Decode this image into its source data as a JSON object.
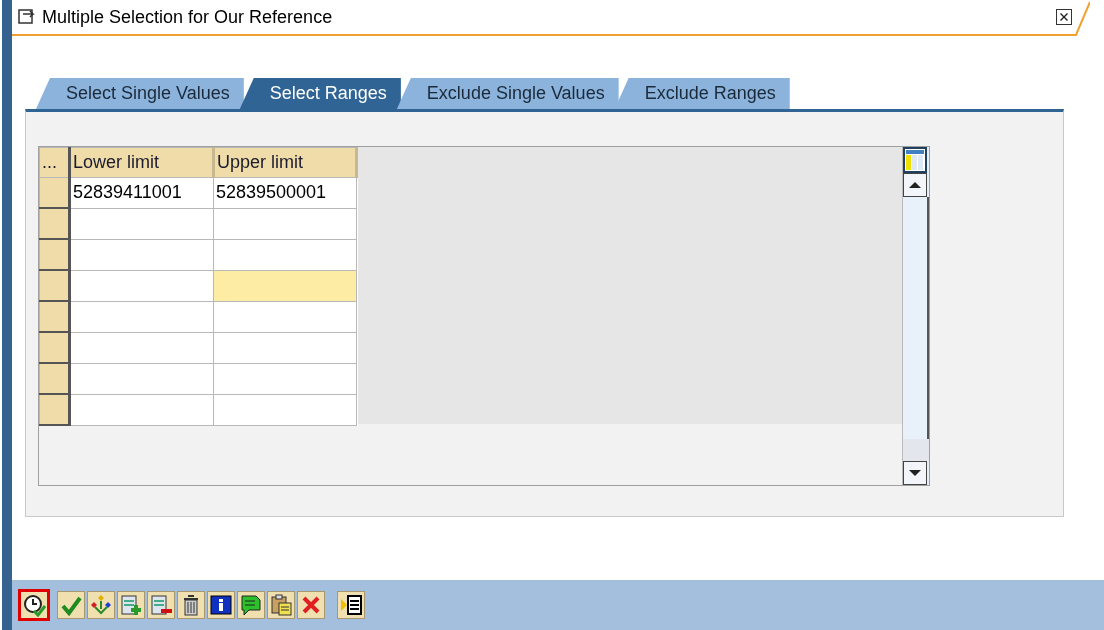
{
  "window": {
    "title": "Multiple Selection for Our Reference"
  },
  "tabs": [
    {
      "label": "Select Single Values",
      "selected": false
    },
    {
      "label": "Select Ranges",
      "selected": true
    },
    {
      "label": "Exclude Single Values",
      "selected": false
    },
    {
      "label": "Exclude Ranges",
      "selected": false
    }
  ],
  "table": {
    "corner": "...",
    "columns": [
      "Lower limit",
      "Upper limit"
    ],
    "rows": [
      {
        "cells": [
          {
            "value": "52839411001",
            "selected": false
          },
          {
            "value": "52839500001",
            "selected": false
          }
        ]
      },
      {
        "cells": [
          {
            "selected": false
          },
          {
            "selected": false
          }
        ]
      },
      {
        "cells": [
          {
            "selected": false
          },
          {
            "selected": false
          }
        ]
      },
      {
        "cells": [
          {
            "selected": false
          },
          {
            "selected": true
          }
        ]
      },
      {
        "cells": [
          {
            "selected": false
          },
          {
            "selected": false
          }
        ]
      },
      {
        "cells": [
          {
            "selected": false
          },
          {
            "selected": false
          }
        ]
      },
      {
        "cells": [
          {
            "selected": false
          },
          {
            "selected": false
          }
        ]
      },
      {
        "cells": [
          {
            "selected": false
          },
          {
            "selected": false
          }
        ]
      }
    ]
  },
  "toolbar": {
    "highlighted_button": {
      "kind": "execute"
    },
    "buttons": [
      {
        "kind": "check"
      },
      {
        "kind": "hierarchy"
      },
      {
        "kind": "insert-row"
      },
      {
        "kind": "delete-row"
      },
      {
        "kind": "trash"
      },
      {
        "kind": "info"
      },
      {
        "kind": "comment"
      },
      {
        "kind": "paste"
      },
      {
        "kind": "cancel"
      },
      {
        "kind": "import"
      }
    ]
  }
}
